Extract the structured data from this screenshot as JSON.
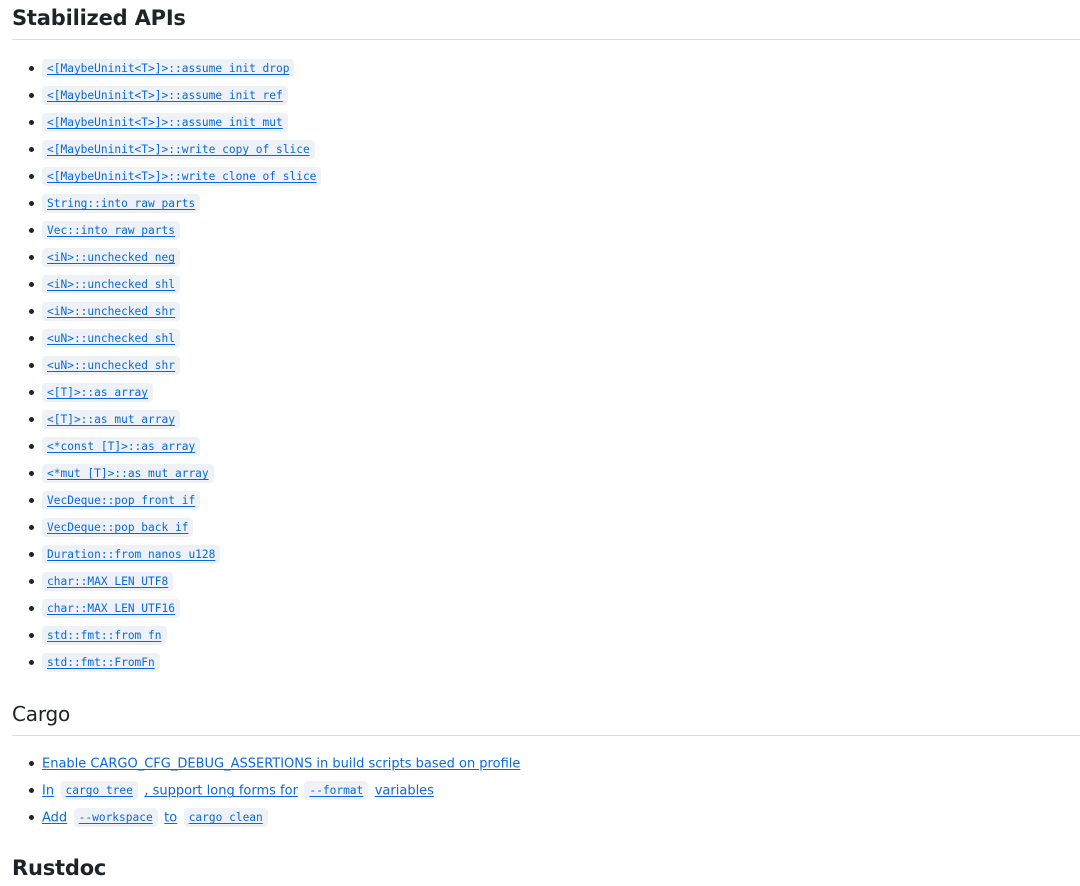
{
  "sections": {
    "stabilized_apis": {
      "title": "Stabilized APIs",
      "items": [
        "<[MaybeUninit<T>]>::assume_init_drop",
        "<[MaybeUninit<T>]>::assume_init_ref",
        "<[MaybeUninit<T>]>::assume_init_mut",
        "<[MaybeUninit<T>]>::write_copy_of_slice",
        "<[MaybeUninit<T>]>::write_clone_of_slice",
        "String::into_raw_parts",
        "Vec::into_raw_parts",
        "<iN>::unchecked_neg",
        "<iN>::unchecked_shl",
        "<iN>::unchecked_shr",
        "<uN>::unchecked_shl",
        "<uN>::unchecked_shr",
        "<[T]>::as_array",
        "<[T]>::as_mut_array",
        "<*const [T]>::as_array",
        "<*mut [T]>::as_mut_array",
        "VecDeque::pop_front_if",
        "VecDeque::pop_back_if",
        "Duration::from_nanos_u128",
        "char::MAX_LEN_UTF8",
        "char::MAX_LEN_UTF16",
        "std::fmt::from_fn",
        "std::fmt::FromFn"
      ]
    },
    "cargo": {
      "title": "Cargo",
      "item1": {
        "text": "Enable CARGO_CFG_DEBUG_ASSERTIONS in build scripts based on profile"
      },
      "item2": {
        "prefix": "In",
        "code1": "cargo tree",
        "middle": ", support long forms for",
        "code2": "--format",
        "suffix": "variables"
      },
      "item3": {
        "prefix": "Add",
        "code1": "--workspace",
        "middle": "to",
        "code2": "cargo clean"
      }
    },
    "rustdoc": {
      "title": "Rustdoc"
    }
  }
}
